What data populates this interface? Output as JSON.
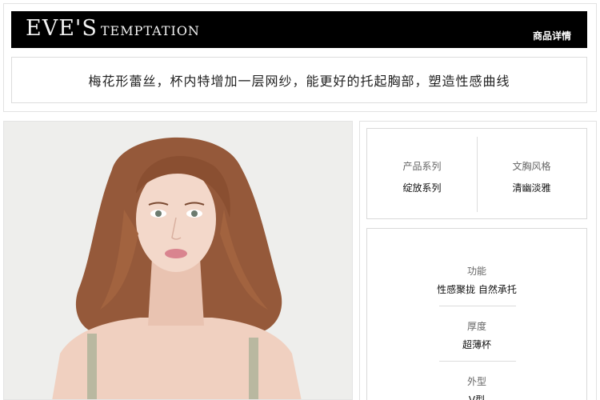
{
  "brand": {
    "logo_main": "EVE'S",
    "logo_sub": "TEMPTATION",
    "detail_link": "商品详情"
  },
  "tagline": "梅花形蕾丝，杯内特增加一层网纱，能更好的托起胸部，塑造性感曲线",
  "specs_top": [
    {
      "label": "产品系列",
      "value": "绽放系列"
    },
    {
      "label": "文胸风格",
      "value": "清幽淡雅"
    }
  ],
  "specs_list": [
    {
      "label": "功能",
      "value": "性感聚拢 自然承托"
    },
    {
      "label": "厚度",
      "value": "超薄杯"
    },
    {
      "label": "外型",
      "value": "V型"
    }
  ],
  "colors": {
    "bar": "#000000",
    "hair": "#9a5a38",
    "skin": "#f1d2c2",
    "photo_bg": "#eeeeec",
    "strap": "#b9b8a0"
  }
}
